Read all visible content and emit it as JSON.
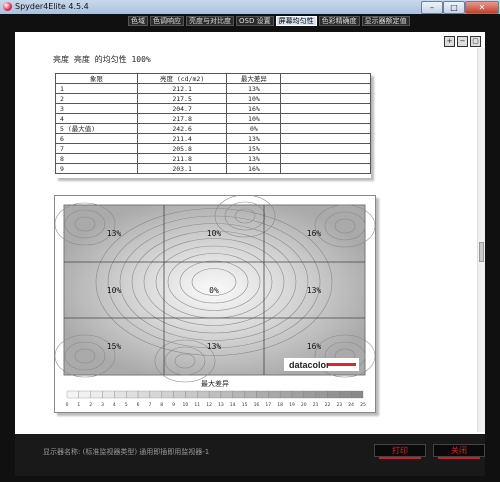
{
  "window": {
    "title": "Spyder4Elite 4.5.4",
    "min": "–",
    "max": "□",
    "close": "✕"
  },
  "tabs": [
    {
      "label": "色域",
      "active": false
    },
    {
      "label": "色调响应",
      "active": false
    },
    {
      "label": "亮度与对比度",
      "active": false
    },
    {
      "label": "OSD 设置",
      "active": false
    },
    {
      "label": "屏幕均匀性",
      "active": true
    },
    {
      "label": "色彩精确度",
      "active": false
    },
    {
      "label": "显示器额定值",
      "active": false
    }
  ],
  "report": {
    "heading": "亮度 亮度 的均匀性 100%",
    "table": {
      "headers": [
        "象限",
        "亮度 (cd/m2)",
        "最大差异"
      ],
      "rows": [
        [
          "1",
          "212.1",
          "13%"
        ],
        [
          "2",
          "217.5",
          "10%"
        ],
        [
          "3",
          "204.7",
          "16%"
        ],
        [
          "4",
          "217.8",
          "10%"
        ],
        [
          "5 (最大值)",
          "242.6",
          "0%"
        ],
        [
          "6",
          "211.4",
          "13%"
        ],
        [
          "7",
          "205.8",
          "15%"
        ],
        [
          "8",
          "211.8",
          "13%"
        ],
        [
          "9",
          "203.1",
          "16%"
        ]
      ]
    },
    "plot": {
      "cells": [
        "13%",
        "10%",
        "16%",
        "10%",
        "0%",
        "13%",
        "15%",
        "13%",
        "16%"
      ],
      "logo": "datacolor",
      "scale_title": "最大差异",
      "scale_ticks": [
        "0",
        "1",
        "2",
        "3",
        "4",
        "5",
        "6",
        "7",
        "8",
        "9",
        "10",
        "11",
        "12",
        "13",
        "14",
        "15",
        "16",
        "17",
        "18",
        "19",
        "20",
        "21",
        "22",
        "23",
        "24",
        "25"
      ]
    }
  },
  "footer": {
    "monitor_label": "显示器名称: (标准监视器类型) 通用即插即用监视器-1",
    "print_label": "打印",
    "close_label": "关闭"
  }
}
